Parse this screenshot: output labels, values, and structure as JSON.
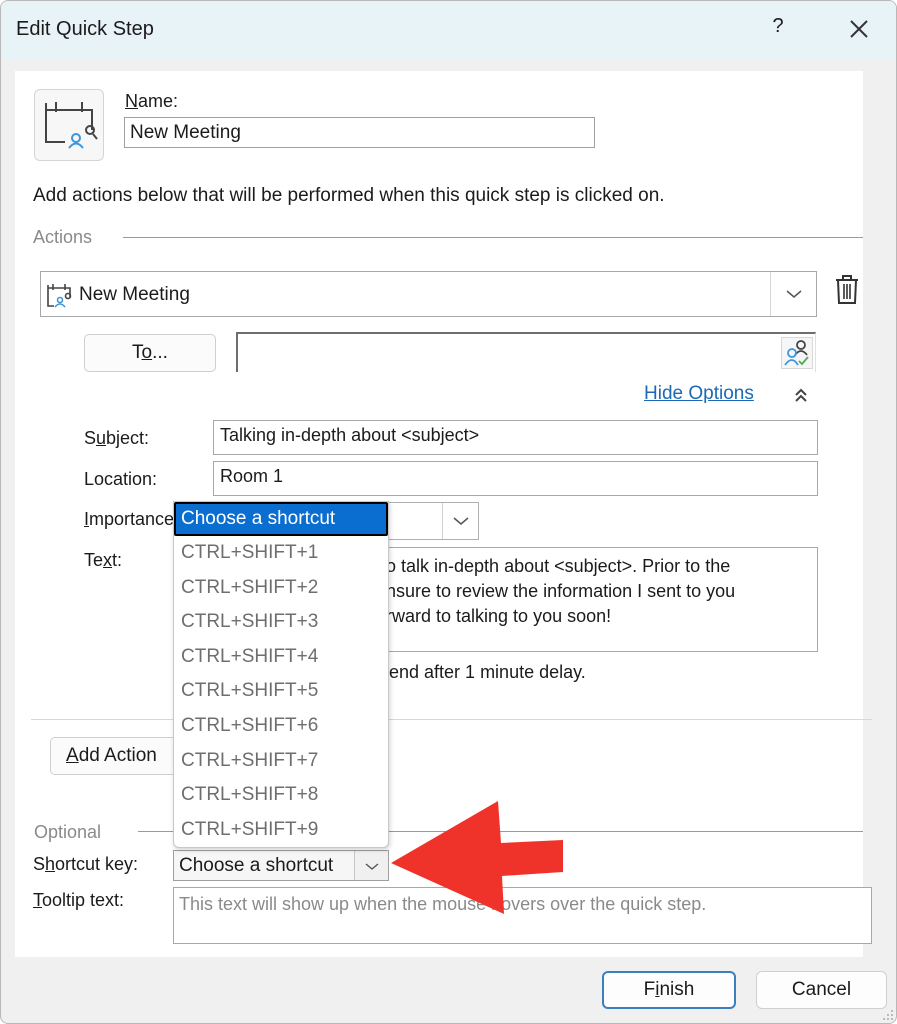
{
  "window": {
    "title": "Edit Quick Step",
    "help_label": "?",
    "close_icon": "close-icon"
  },
  "name_section": {
    "icon": "calendar-meeting-icon",
    "label_underline": "N",
    "label_rest": "ame:",
    "value": "New Meeting"
  },
  "instructions": "Add actions below that will be performed when this quick step is clicked on.",
  "actions_section": {
    "label": "Actions",
    "action_type": {
      "icon": "calendar-meeting-icon",
      "value": "New Meeting"
    },
    "delete_icon": "trash-icon",
    "to_button": {
      "pre": "T",
      "underline": "o",
      "post": "..."
    },
    "to_value": "",
    "address_book_icon": "address-book-check-icon",
    "hide_options_label": "Hide Options",
    "hide_options_icon": "double-chevron-up-icon",
    "fields": {
      "subject": {
        "pre": "S",
        "underline": "u",
        "post": "bject:",
        "value": "Talking in-depth about <subject>"
      },
      "location": {
        "label": "Location:",
        "value": "Room 1"
      },
      "importance": {
        "underline": "I",
        "post": "mportance:",
        "value": ""
      },
      "text": {
        "pre": "Te",
        "underline": "x",
        "post": "t:",
        "value_visible": "o talk in-depth about <subject>. Prior to the\nnsure to review the information I sent to you\nrward to talking to you soon!"
      }
    },
    "send_note_visible": "end after 1 minute delay."
  },
  "add_action_button": {
    "underline": "A",
    "post": "dd Action"
  },
  "optional_section": {
    "label": "Optional",
    "shortcut_key": {
      "pre": "S",
      "underline": "h",
      "post": "ortcut key:",
      "value": "Choose a shortcut",
      "options": [
        "Choose a shortcut",
        "CTRL+SHIFT+1",
        "CTRL+SHIFT+2",
        "CTRL+SHIFT+3",
        "CTRL+SHIFT+4",
        "CTRL+SHIFT+5",
        "CTRL+SHIFT+6",
        "CTRL+SHIFT+7",
        "CTRL+SHIFT+8",
        "CTRL+SHIFT+9"
      ],
      "highlighted_index": 0
    },
    "tooltip": {
      "underline": "T",
      "post": "ooltip text:",
      "placeholder": "This text will show up when the mouse hovers over the quick step."
    }
  },
  "buttons": {
    "finish": {
      "pre": "F",
      "underline": "i",
      "post": "nish"
    },
    "cancel": "Cancel"
  },
  "annotation": {
    "type": "red-arrow",
    "color": "#f0332a",
    "points_to": "shortcut-key-dropdown"
  },
  "colors": {
    "titlebar": "#e8f3f8",
    "link": "#1b6ab5",
    "selection": "#0a6ed1",
    "finish_border": "#3c7fc0"
  }
}
